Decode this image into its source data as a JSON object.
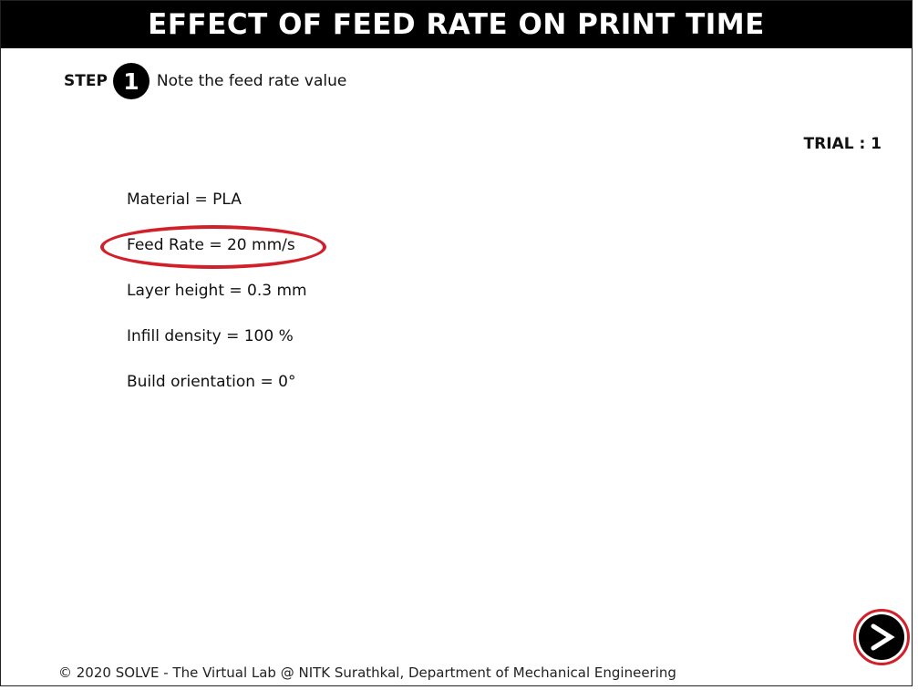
{
  "header": {
    "title": "EFFECT OF FEED RATE ON PRINT TIME"
  },
  "step": {
    "label": "STEP",
    "number": "1",
    "instruction": "Note the feed rate value"
  },
  "trial": "TRIAL : 1",
  "parameters": [
    "Material = PLA",
    "Feed Rate = 20 mm/s",
    "Layer height = 0.3 mm",
    "Infill density = 100 %",
    "Build orientation = 0°"
  ],
  "navigation": {
    "next_icon": "chevron-right-icon"
  },
  "colors": {
    "highlight": "#d1202a",
    "title_bg": "#000000"
  },
  "footer": "© 2020 SOLVE - The Virtual Lab @ NITK Surathkal, Department of Mechanical Engineering"
}
